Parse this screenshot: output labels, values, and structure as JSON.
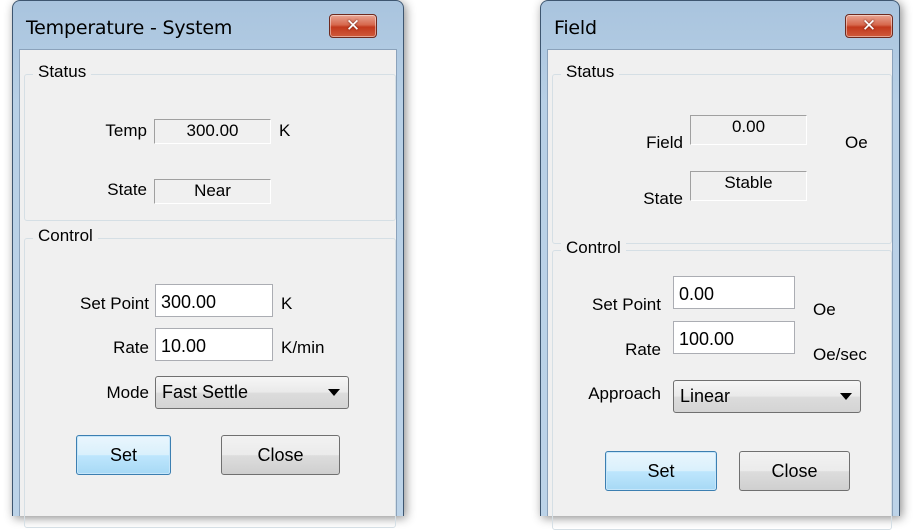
{
  "temperature_window": {
    "title": "Temperature - System",
    "close_glyph": "✕",
    "status": {
      "group_label": "Status",
      "temp_label": "Temp",
      "temp_value": "300.00",
      "temp_unit": "K",
      "state_label": "State",
      "state_value": "Near"
    },
    "control": {
      "group_label": "Control",
      "setpoint_label": "Set Point",
      "setpoint_value": "300.00",
      "setpoint_unit": "K",
      "rate_label": "Rate",
      "rate_value": "10.00",
      "rate_unit": "K/min",
      "mode_label": "Mode",
      "mode_selected": "Fast Settle"
    },
    "buttons": {
      "set": "Set",
      "close": "Close"
    }
  },
  "field_window": {
    "title": "Field",
    "close_glyph": "✕",
    "status": {
      "group_label": "Status",
      "field_label": "Field",
      "field_value": "0.00",
      "field_unit": "Oe",
      "state_label": "State",
      "state_value": "Stable"
    },
    "control": {
      "group_label": "Control",
      "setpoint_label": "Set Point",
      "setpoint_value": "0.00",
      "setpoint_unit": "Oe",
      "rate_label": "Rate",
      "rate_value": "100.00",
      "rate_unit": "Oe/sec",
      "approach_label": "Approach",
      "approach_selected": "Linear"
    },
    "buttons": {
      "set": "Set",
      "close": "Close"
    }
  },
  "icons": {
    "close": "close-icon",
    "dropdown": "chevron-down-icon"
  },
  "colors": {
    "titlebar": "#b8d0e6",
    "close_button": "#c2391d",
    "default_button": "#bee6fd",
    "dialog_face": "#f0f0f0"
  }
}
